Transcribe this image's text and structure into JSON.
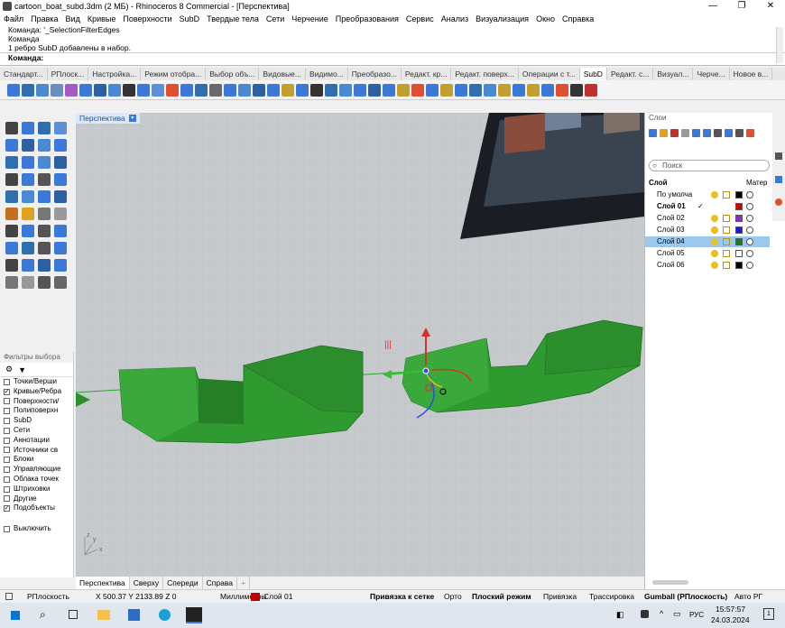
{
  "window": {
    "title": "cartoon_boat_subd.3dm (2 МБ) - Rhinoceros 8 Commercial - [Перспектива]",
    "minimize_glyph": "—",
    "restore_glyph": "❐",
    "close_glyph": "✕"
  },
  "menu": [
    "Файл",
    "Правка",
    "Вид",
    "Кривые",
    "Поверхности",
    "SubD",
    "Твердые тела",
    "Сети",
    "Черчение",
    "Преобразования",
    "Сервис",
    "Анализ",
    "Визуализация",
    "Окно",
    "Справка"
  ],
  "command_history": [
    "Команда: '_SelectionFilterEdges",
    "Команда",
    "1 ребро SubD добавлены в набор."
  ],
  "command_prompt": "Команда:",
  "toolbar_tabs": {
    "items": [
      "Стандарт...",
      "РПлоск...",
      "Настройка...",
      "Режим отобра...",
      "Выбор объ...",
      "Видовые...",
      "Видимо...",
      "Преобразо...",
      "Редакт. кр...",
      "Редакт. поверх...",
      "Операции с т...",
      "SubD",
      "Редакт. с...",
      "Визуал...",
      "Черче...",
      "Новое в..."
    ],
    "active": "SubD"
  },
  "viewport": {
    "label": "Перспектива",
    "dropdown_glyph": "▾",
    "gumball_marks": "|||",
    "axis_x": "x",
    "axis_y": "y",
    "axis_z": "z",
    "tabs": [
      "Перспектива",
      "Сверху",
      "Спереди",
      "Справа"
    ],
    "add_tab_glyph": "+"
  },
  "selection_filters": {
    "title": "Фильтры выбора",
    "items": [
      {
        "label": "Точки/Верши",
        "checked": false
      },
      {
        "label": "Кривые/Ребра",
        "checked": true
      },
      {
        "label": "Поверхности/",
        "checked": false
      },
      {
        "label": "Полиповерхн",
        "checked": false
      },
      {
        "label": "SubD",
        "checked": false
      },
      {
        "label": "Сети",
        "checked": false
      },
      {
        "label": "Аннотации",
        "checked": false
      },
      {
        "label": "Источники св",
        "checked": false
      },
      {
        "label": "Блоки",
        "checked": false
      },
      {
        "label": "Управляющие",
        "checked": false
      },
      {
        "label": "Облака точек",
        "checked": false
      },
      {
        "label": "Штриховки",
        "checked": false
      },
      {
        "label": "Другие",
        "checked": false
      },
      {
        "label": "Подобъекты",
        "checked": true
      }
    ],
    "disable_label": "Выключить",
    "check_glyph": "✓"
  },
  "layers": {
    "title": "Слои",
    "search_placeholder": "Поиск",
    "col_layer": "Слой",
    "col_material": "Матер",
    "current_mark": "✓",
    "rows": [
      {
        "name": "По умолча",
        "color": "#000000",
        "current": false,
        "selected": false
      },
      {
        "name": "Слой 01",
        "color": "#d40000",
        "current": true,
        "selected": false
      },
      {
        "name": "Слой 02",
        "color": "#8b2fc9",
        "current": false,
        "selected": false
      },
      {
        "name": "Слой 03",
        "color": "#1a1ad4",
        "current": false,
        "selected": false
      },
      {
        "name": "Слой 04",
        "color": "#1f7a1f",
        "current": false,
        "selected": true
      },
      {
        "name": "Слой 05",
        "color": "#ffffff",
        "current": false,
        "selected": false
      },
      {
        "name": "Слой 06",
        "color": "#000000",
        "current": false,
        "selected": false
      }
    ]
  },
  "status": {
    "cplane": "РПлоскость",
    "coords": "X 500.37 Y 2133.89 Z 0",
    "units": "Миллиметры",
    "layer": "Слой 01",
    "layer_color": "#c00000",
    "snap": "Привязка к сетке",
    "ortho": "Орто",
    "planar": "Плоский режим",
    "osnap": "Привязка",
    "history": "Трассировка",
    "gumball": "Gumball (РПлоскость)",
    "autocplane": "Авто РГ"
  },
  "taskbar": {
    "lang": "РУС",
    "time": "15:57:57",
    "date": "24.03.2024",
    "notify_count": "1"
  }
}
